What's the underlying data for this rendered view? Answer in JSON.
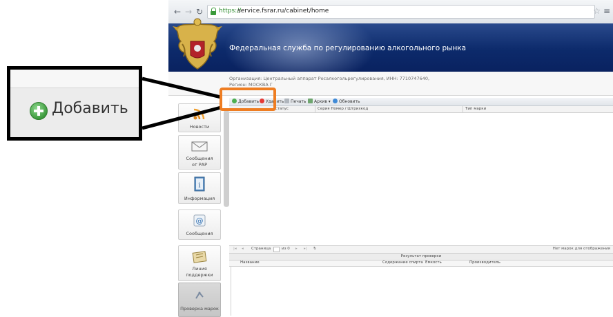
{
  "browser": {
    "url_scheme": "https://",
    "url_host": "service.fsrar.ru/cabinet/home",
    "back_icon": "back-arrow-icon",
    "forward_icon": "forward-arrow-icon",
    "reload_icon": "reload-icon"
  },
  "header": {
    "title": "Федеральная служба по регулированию алкогольного рынка",
    "org_line": "Организация: Центральный аппарат Росалкогольрегулирования, ИНН: 7710747640,",
    "region_line": "Регион: МОСКВА Г"
  },
  "sidebar": {
    "items": [
      {
        "label": "Новости",
        "icon": "rss-icon"
      },
      {
        "label": "Сообщения",
        "label2": "от РАР",
        "icon": "envelope-icon"
      },
      {
        "label": "Информация",
        "icon": "info-book-icon"
      },
      {
        "label": "Сообщения",
        "icon": "at-sign-icon"
      },
      {
        "label": "Линия",
        "label2": "поддержки",
        "icon": "support-icon"
      },
      {
        "label": "Проверка марок",
        "icon": "check-marks-icon"
      }
    ]
  },
  "toolbar": {
    "add_label": "Добавить",
    "delete_label": "Удалить",
    "print_label": "Печать",
    "archive_label": "Архив ▾",
    "refresh_label": "Обновить"
  },
  "grid": {
    "columns": [
      "Статус",
      "Серия Номер / Штрихкод",
      "Тип марки"
    ]
  },
  "pager": {
    "page_label": "Страница",
    "of_label": "из 0",
    "empty_text": "Нет марок для отображения"
  },
  "results": {
    "title": "Результат проверки",
    "columns": [
      "Название",
      "Содержание спирта",
      "Емкость",
      "Производитель"
    ]
  },
  "callout": {
    "label": "Добавить"
  },
  "colors": {
    "highlight": "#ee7d22",
    "banner": "#0c2a6b"
  }
}
